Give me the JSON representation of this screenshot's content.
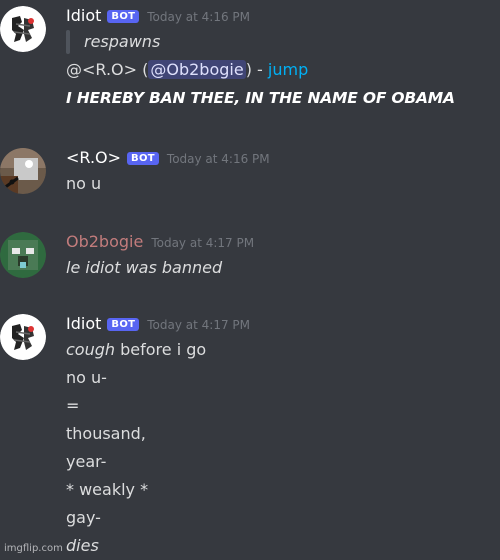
{
  "messages": [
    {
      "username": "Idiot",
      "bot_tag": "BOT",
      "timestamp": "Today at 4:16 PM",
      "quote": "respawns",
      "reply_prefix": "@<R.O> (",
      "mention": "@Ob2bogie",
      "reply_suffix": ") - ",
      "link": "jump",
      "announcement": "I HEREBY BAN THEE, IN THE NAME OF OBAMA"
    },
    {
      "username": "<R.O>",
      "bot_tag": "BOT",
      "timestamp": "Today at 4:16 PM",
      "text": "no u"
    },
    {
      "username": "Ob2bogie",
      "username_color": "#c27c7c",
      "timestamp": "Today at 4:17 PM",
      "text": "le idiot was banned"
    },
    {
      "username": "Idiot",
      "bot_tag": "BOT",
      "timestamp": "Today at 4:17 PM",
      "first_italic": "cough",
      "first_rest": " before i go",
      "lines": [
        "no u-",
        "=",
        "thousand,",
        "year-",
        "* weakly *",
        "gay-"
      ],
      "last_italic": "dies"
    }
  ],
  "watermark": "imgflip.com",
  "colors": {
    "background": "#36393f",
    "bot_tag": "#5865f2",
    "link": "#00b0f4",
    "timestamp": "#72767d"
  }
}
